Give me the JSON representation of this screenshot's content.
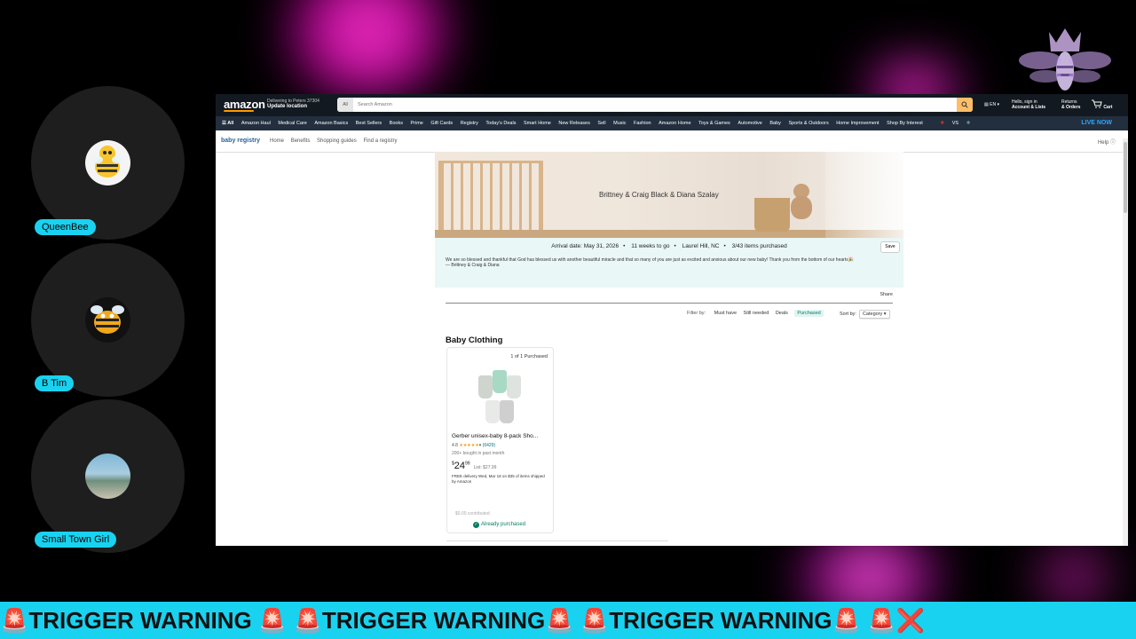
{
  "participants": [
    {
      "name": "QueenBee",
      "avatar": "bee-avatar-icon"
    },
    {
      "name": "B Tim",
      "avatar": "bee-avatar-icon"
    },
    {
      "name": "Small Town Girl",
      "avatar": "beach-photo-avatar"
    }
  ],
  "amazon": {
    "logo": "amazon",
    "deliver_line1": "Delivering to Peters 37304",
    "deliver_line2": "Update location",
    "search_category": "All",
    "search_placeholder": "Search Amazon",
    "lang": "EN",
    "account_line1": "Hello, sign in",
    "account_line2": "Account & Lists",
    "returns_line1": "Returns",
    "returns_line2": "& Orders",
    "cart": "Cart",
    "nav_items": [
      "All",
      "Amazon Haul",
      "Medical Care",
      "Amazon Basics",
      "Best Sellers",
      "Books",
      "Prime",
      "Gift Cards",
      "Registry",
      "Today's Deals",
      "Smart Home",
      "New Releases",
      "Sell",
      "Music",
      "Fashion",
      "Amazon Home",
      "Toys & Games",
      "Automotive",
      "Baby",
      "Sports & Outdoors",
      "Home Improvement",
      "Shop By Interest"
    ],
    "nav_vs": "VS",
    "live_now": "LIVE NOW"
  },
  "registry_nav": {
    "brand": "baby registry",
    "links": [
      "Home",
      "Benefits",
      "Shopping guides",
      "Find a registry"
    ],
    "help": "Help"
  },
  "registry": {
    "title": "Brittney & Craig Black & Diana Szalay",
    "arrival": "Arrival date: May 31, 2026",
    "weeks": "11 weeks to go",
    "location": "Laurel Hill, NC",
    "purchased_count": "3/43 items purchased",
    "save": "Save",
    "message": "We are so blessed and thankful that God has blessed us with another beautiful miracle and that so many of you are just as excited and anxious about our new baby! Thank you from the bottom of our hearts",
    "signature": "— Brittney & Craig & Diana",
    "share": "Share",
    "filter_label": "Filter by:",
    "filters": [
      "Must have",
      "Still needed",
      "Deals",
      "Purchased"
    ],
    "active_filter": "Purchased",
    "sort_label": "Sort by:",
    "sort_value": "Category"
  },
  "section": {
    "title": "Baby Clothing"
  },
  "product": {
    "purchased": "1 of 1 Purchased",
    "title": "Gerber unisex-baby 8-pack Sho...",
    "rating": "4.8",
    "reviews": "(6429)",
    "bought": "200+ bought in past month",
    "price_dollars": "24",
    "price_cents": "99",
    "list_price": "List: $27.99",
    "delivery": "FREE delivery Wed, Mar 18 on $35 of items shipped by Amazon",
    "contributed": "$0.00 contributed",
    "status": "Already purchased"
  },
  "ticker": "🚨TRIGGER WARNING 🚨 🚨TRIGGER WARNING🚨 🚨TRIGGER WARNING🚨  🚨❌",
  "colors": {
    "cyan": "#19d2f0",
    "amazon_dark": "#131921",
    "amazon_nav": "#232f3e",
    "search_button": "#febd69",
    "registry_mint": "#e9f7f6",
    "success_green": "#067d62"
  }
}
